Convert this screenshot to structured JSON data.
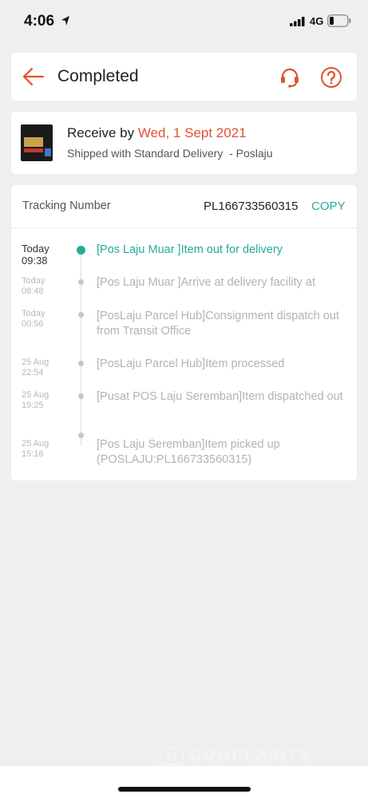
{
  "status_bar": {
    "time": "4:06",
    "network": "4G",
    "icons": [
      "location-arrow-icon",
      "signal-icon",
      "battery-icon"
    ]
  },
  "header": {
    "title": "Completed",
    "icons": [
      "back-arrow-icon",
      "headset-icon",
      "help-icon"
    ]
  },
  "delivery": {
    "receive_prefix": "Receive by ",
    "receive_date": "Wed, 1 Sept 2021",
    "shipping": "Shipped with Standard Delivery  - Poslaju"
  },
  "tracking": {
    "label": "Tracking Number",
    "number": "PL166733560315",
    "copy": "COPY",
    "events": [
      {
        "date": "Today",
        "time": "09:38",
        "desc": "[Pos Laju Muar ]Item out for delivery",
        "current": true
      },
      {
        "date": "Today",
        "time": "08:48",
        "desc": "[Pos Laju Muar ]Arrive at delivery facility at"
      },
      {
        "date": "Today",
        "time": "00:56",
        "desc": "[PosLaju Parcel Hub]Consignment dispatch out from Transit Office"
      },
      {
        "date": "25 Aug",
        "time": "22:54",
        "desc": "[PosLaju Parcel Hub]Item processed"
      },
      {
        "date": "25 Aug",
        "time": "19:25",
        "desc": "[Pusat POS Laju Seremban]Item dispatched out"
      },
      {
        "date": "25 Aug",
        "time": "15:16",
        "desc": "[Pos Laju Seremban]Item picked up (POSLAJU:PL166733560315)"
      }
    ]
  },
  "watermark": {
    "text": "COMPLAINTS"
  },
  "colors": {
    "accent_orange": "#e0532e",
    "accent_green": "#26aa99",
    "background": "#efefef"
  }
}
